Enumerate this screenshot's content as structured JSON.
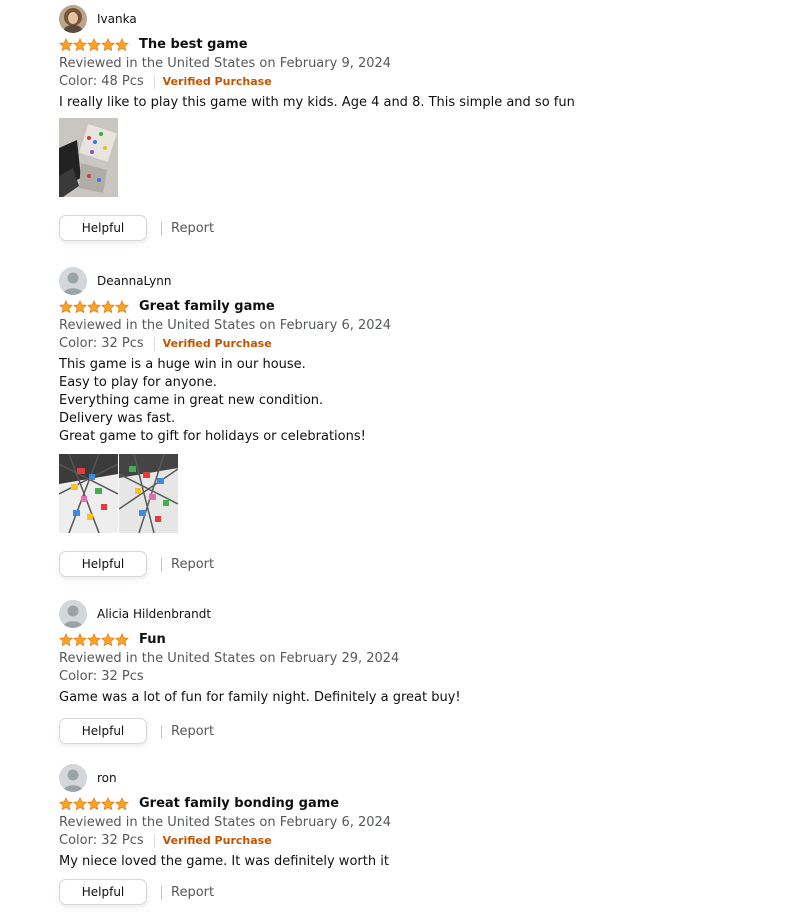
{
  "colors": {
    "star": "#ffa41c",
    "verified": "#c45500",
    "muted_text": "#565959",
    "text": "#0f1111"
  },
  "reviews": [
    {
      "profile_name": "Ivanka",
      "avatar": "user-photo",
      "rating": 5,
      "title": "The best game",
      "date": "Reviewed in the United States on February 9, 2024",
      "variant": "Color: 48 Pcs",
      "verified": "Verified Purchase",
      "body": [
        "I really like to play this game with my kids. Age 4 and 8. This simple and so fun"
      ],
      "image_count": 1,
      "helpful": "Helpful",
      "report": "Report"
    },
    {
      "profile_name": "DeannaLynn",
      "avatar": "default-avatar",
      "rating": 5,
      "title": "Great family game",
      "date": "Reviewed in the United States on February 6, 2024",
      "variant": "Color: 32 Pcs",
      "verified": "Verified Purchase",
      "body": [
        "This game is a huge win in our house.",
        "Easy to play for anyone.",
        "Everything came in great new condition.",
        "Delivery was fast.",
        "Great game to gift for holidays or celebrations!"
      ],
      "image_count": 2,
      "helpful": "Helpful",
      "report": "Report"
    },
    {
      "profile_name": "Alicia Hildenbrandt",
      "avatar": "default-avatar",
      "rating": 5,
      "title": "Fun",
      "date": "Reviewed in the United States on February 29, 2024",
      "variant": "Color: 32 Pcs",
      "body": [
        "Game was a lot of fun for family night. Definitely a great buy!"
      ],
      "image_count": 0,
      "helpful": "Helpful",
      "report": "Report"
    },
    {
      "profile_name": "ron",
      "avatar": "default-avatar",
      "rating": 5,
      "title": "Great family bonding game",
      "date": "Reviewed in the United States on February 6, 2024",
      "variant": "Color: 32 Pcs",
      "verified": "Verified Purchase",
      "body": [
        "My niece loved the game. It was definitely worth it"
      ],
      "image_count": 0,
      "helpful": "Helpful",
      "report": "Report"
    }
  ]
}
